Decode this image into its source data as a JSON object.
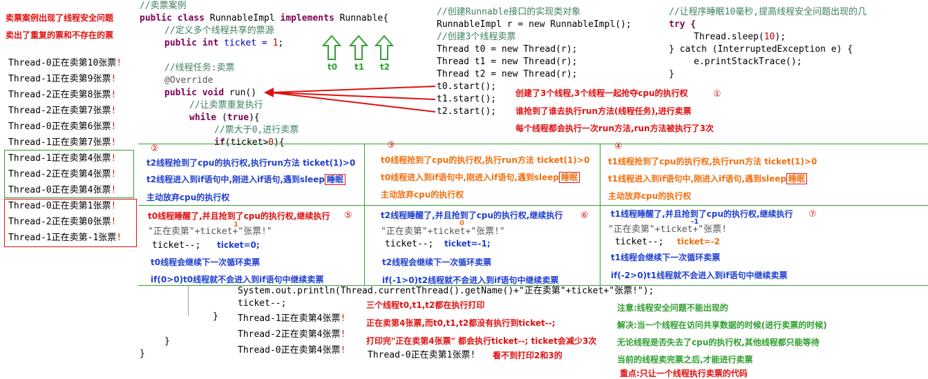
{
  "top_left_title": {
    "line1": "卖票案例出现了线程安全问题",
    "line2": "卖出了重复的票和不存在的票"
  },
  "console_output": [
    "Thread-0正在卖第10张票!",
    "Thread-1正在卖第9张票!",
    "Thread-2正在卖第8张票!",
    "Thread-2正在卖第7张票!",
    "Thread-0正在卖第6张票!",
    "Thread-1正在卖第7张票!",
    "Thread-1正在卖第4张票!",
    "Thread-2正在卖第4张票!",
    "Thread-0正在卖第4张票!",
    "Thread-0正在卖第1张票!",
    "Thread-2正在卖第0张票!",
    "Thread-1正在卖第-1张票!"
  ],
  "code_main": {
    "l1": "//卖票案例",
    "l2a": "public class",
    "l2b": " RunnableImpl ",
    "l2c": "implements",
    "l2d": " Runnable{",
    "l3": "//定义多个线程共享的票源",
    "l4a": "public int",
    "l4b": " ticket = ",
    "l4c": "1",
    "l4d": ";",
    "l5": "//线程任务:卖票",
    "l6": "@Override",
    "l7a": "public void",
    "l7b": " run()",
    "l8": "//让卖票重复执行",
    "l9a": "while",
    "l9b": " (",
    "l9c": "true",
    "l9d": "){",
    "l10": "//票大于0,进行卖票",
    "l11a": "if",
    "l11b": "(ticket>",
    "l11c": "0",
    "l11d": "){"
  },
  "thread_labels": [
    "t0",
    "t1",
    "t2"
  ],
  "code_create": {
    "c1": "//创建Runnable接口的实现类对象",
    "c2": "RunnableImpl r = new RunnableImpl();",
    "c3": "//创建3个线程卖票",
    "c4": "Thread t0 = new Thread(r);",
    "c5": "Thread t1 = new Thread(r);",
    "c6": "Thread t2 = new Thread(r);",
    "c7": "t0.start();",
    "c8": "t1.start();",
    "c9": "t2.start();"
  },
  "code_sleep": {
    "s1": "//让程序睡眠10毫秒,提高线程安全问题出现的几",
    "s2": "try {",
    "s3a": "Thread.sleep(",
    "s3b": "10",
    "s3c": ");",
    "s4": "} catch (InterruptedException e) {",
    "s5": "e.printStackTrace();",
    "s6": "}"
  },
  "step1": {
    "num": "①",
    "a": "创建了3个线程,3个线程一起抢夺cpu的执行权",
    "b": "谁抢到了谁去执行run方法(线程任务),进行卖票",
    "c": "每个线程都会执行一次run方法,run方法被执行了3次"
  },
  "step2": {
    "num": "②",
    "a": "t2线程抢到了cpu的执行权,执行run方法 ticket(1)>0",
    "b": "t2线程进入到if语句中,刚进入if语句,遇到sleep",
    "b_hl": "睡眠",
    "c": "主动放弃cpu的执行权"
  },
  "step3": {
    "num": "③",
    "a": "t0线程抢到了cpu的执行权,执行run方法 ticket(1)>0",
    "b": "t0线程进入到if语句中,刚进入if语句,遇到sleep",
    "b_hl": "睡眠",
    "c": "主动放弃cpu的执行权"
  },
  "step4": {
    "num": "④",
    "a": "t1线程抢到了cpu的执行权,执行run方法 ticket(1)>0",
    "b": "t1线程进入到if语句中,刚进入if语句,遇到sleep",
    "b_hl": "睡眠",
    "c": "主动放弃cpu的执行权"
  },
  "step5": {
    "num": "⑤",
    "a": "t0线程睡醒了,并且抢到了cpu的执行权,继续执行",
    "val": "1",
    "code": "\"正在卖第\"+ticket+\"张票!\"",
    "dec": "ticket--;",
    "res": "ticket=0;",
    "b": "t0线程会继续下一次循环卖票",
    "c": "if(0>0)t0线程就不会进入到if语句中继续卖票"
  },
  "step6": {
    "num": "⑥",
    "a": "t2线程睡醒了,并且抢到了cpu的执行权,继续执行",
    "val": "0",
    "code": "\"正在卖第\"+ticket+\"张票!\"",
    "dec": "ticket--;",
    "res": "ticket=-1;",
    "b": "t2线程会继续下一次循环卖票",
    "c": "if(-1>0)t2线程就不会进入到if语句中继续卖票"
  },
  "step7": {
    "num": "⑦",
    "a": "t1线程睡醒了,并且抢到了cpu的执行权,继续执行",
    "val": "-1",
    "code": "\"正在卖第\"+ticket+\"张票!",
    "dec": "ticket--;",
    "res": "ticket=-2",
    "b": "t1线程会继续下一次循环卖票",
    "c": "if(-2>0)t1线程就不会进入到if语句中继续卖票"
  },
  "code_bottom": {
    "println": "System.out.println(Thread.currentThread().getName()+\"正在卖第\"+ticket+\"张票!\");",
    "dec": "ticket--;",
    "brace1": "}",
    "brace2": "}",
    "brace3": "}"
  },
  "bottom_output": [
    "Thread-1正在卖第4张票!",
    "Thread-2正在卖第4张票!",
    "Thread-0正在卖第4张票!"
  ],
  "bottom_explain": {
    "a": "三个线程t0,t1,t2都在执行打印",
    "b": "正在卖第4张票,而t0,t1,t2都没有执行到ticket--;",
    "c": "打印完\"正在卖第4张票\" 都会执行ticket--; ticket会减少3次",
    "d_out": "Thread-0正在卖第1张票!",
    "d_note": "看不到打印2和3的"
  },
  "conclusion": {
    "a": "注意:线程安全问题不能出现的",
    "b": "解决:当一个线程在访问共享数据的时候(进行卖票的时候)",
    "c": "无论线程是否失去了cpu的执行权,其他线程都只能等待",
    "d": "当前的线程卖完票之后,才能进行卖票",
    "e": "重点:只让一个线程执行卖票的代码"
  },
  "colors": {
    "red": "#e01010",
    "blue": "#1f3fd0",
    "green": "#30a030",
    "orange": "#f07010"
  }
}
